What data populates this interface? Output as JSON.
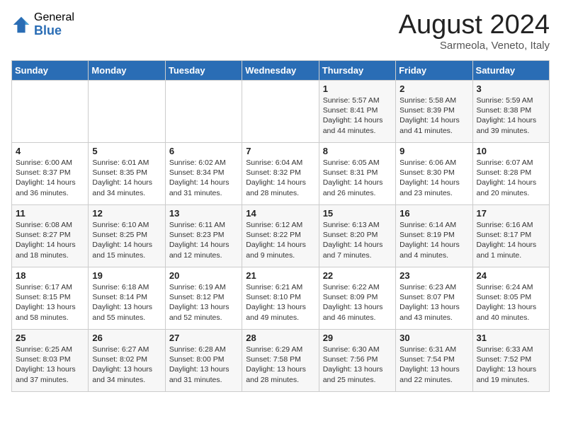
{
  "logo": {
    "general": "General",
    "blue": "Blue"
  },
  "title": "August 2024",
  "location": "Sarmeola, Veneto, Italy",
  "days_of_week": [
    "Sunday",
    "Monday",
    "Tuesday",
    "Wednesday",
    "Thursday",
    "Friday",
    "Saturday"
  ],
  "weeks": [
    [
      {
        "day": "",
        "info": ""
      },
      {
        "day": "",
        "info": ""
      },
      {
        "day": "",
        "info": ""
      },
      {
        "day": "",
        "info": ""
      },
      {
        "day": "1",
        "info": "Sunrise: 5:57 AM\nSunset: 8:41 PM\nDaylight: 14 hours and 44 minutes."
      },
      {
        "day": "2",
        "info": "Sunrise: 5:58 AM\nSunset: 8:39 PM\nDaylight: 14 hours and 41 minutes."
      },
      {
        "day": "3",
        "info": "Sunrise: 5:59 AM\nSunset: 8:38 PM\nDaylight: 14 hours and 39 minutes."
      }
    ],
    [
      {
        "day": "4",
        "info": "Sunrise: 6:00 AM\nSunset: 8:37 PM\nDaylight: 14 hours and 36 minutes."
      },
      {
        "day": "5",
        "info": "Sunrise: 6:01 AM\nSunset: 8:35 PM\nDaylight: 14 hours and 34 minutes."
      },
      {
        "day": "6",
        "info": "Sunrise: 6:02 AM\nSunset: 8:34 PM\nDaylight: 14 hours and 31 minutes."
      },
      {
        "day": "7",
        "info": "Sunrise: 6:04 AM\nSunset: 8:32 PM\nDaylight: 14 hours and 28 minutes."
      },
      {
        "day": "8",
        "info": "Sunrise: 6:05 AM\nSunset: 8:31 PM\nDaylight: 14 hours and 26 minutes."
      },
      {
        "day": "9",
        "info": "Sunrise: 6:06 AM\nSunset: 8:30 PM\nDaylight: 14 hours and 23 minutes."
      },
      {
        "day": "10",
        "info": "Sunrise: 6:07 AM\nSunset: 8:28 PM\nDaylight: 14 hours and 20 minutes."
      }
    ],
    [
      {
        "day": "11",
        "info": "Sunrise: 6:08 AM\nSunset: 8:27 PM\nDaylight: 14 hours and 18 minutes."
      },
      {
        "day": "12",
        "info": "Sunrise: 6:10 AM\nSunset: 8:25 PM\nDaylight: 14 hours and 15 minutes."
      },
      {
        "day": "13",
        "info": "Sunrise: 6:11 AM\nSunset: 8:23 PM\nDaylight: 14 hours and 12 minutes."
      },
      {
        "day": "14",
        "info": "Sunrise: 6:12 AM\nSunset: 8:22 PM\nDaylight: 14 hours and 9 minutes."
      },
      {
        "day": "15",
        "info": "Sunrise: 6:13 AM\nSunset: 8:20 PM\nDaylight: 14 hours and 7 minutes."
      },
      {
        "day": "16",
        "info": "Sunrise: 6:14 AM\nSunset: 8:19 PM\nDaylight: 14 hours and 4 minutes."
      },
      {
        "day": "17",
        "info": "Sunrise: 6:16 AM\nSunset: 8:17 PM\nDaylight: 14 hours and 1 minute."
      }
    ],
    [
      {
        "day": "18",
        "info": "Sunrise: 6:17 AM\nSunset: 8:15 PM\nDaylight: 13 hours and 58 minutes."
      },
      {
        "day": "19",
        "info": "Sunrise: 6:18 AM\nSunset: 8:14 PM\nDaylight: 13 hours and 55 minutes."
      },
      {
        "day": "20",
        "info": "Sunrise: 6:19 AM\nSunset: 8:12 PM\nDaylight: 13 hours and 52 minutes."
      },
      {
        "day": "21",
        "info": "Sunrise: 6:21 AM\nSunset: 8:10 PM\nDaylight: 13 hours and 49 minutes."
      },
      {
        "day": "22",
        "info": "Sunrise: 6:22 AM\nSunset: 8:09 PM\nDaylight: 13 hours and 46 minutes."
      },
      {
        "day": "23",
        "info": "Sunrise: 6:23 AM\nSunset: 8:07 PM\nDaylight: 13 hours and 43 minutes."
      },
      {
        "day": "24",
        "info": "Sunrise: 6:24 AM\nSunset: 8:05 PM\nDaylight: 13 hours and 40 minutes."
      }
    ],
    [
      {
        "day": "25",
        "info": "Sunrise: 6:25 AM\nSunset: 8:03 PM\nDaylight: 13 hours and 37 minutes."
      },
      {
        "day": "26",
        "info": "Sunrise: 6:27 AM\nSunset: 8:02 PM\nDaylight: 13 hours and 34 minutes."
      },
      {
        "day": "27",
        "info": "Sunrise: 6:28 AM\nSunset: 8:00 PM\nDaylight: 13 hours and 31 minutes."
      },
      {
        "day": "28",
        "info": "Sunrise: 6:29 AM\nSunset: 7:58 PM\nDaylight: 13 hours and 28 minutes."
      },
      {
        "day": "29",
        "info": "Sunrise: 6:30 AM\nSunset: 7:56 PM\nDaylight: 13 hours and 25 minutes."
      },
      {
        "day": "30",
        "info": "Sunrise: 6:31 AM\nSunset: 7:54 PM\nDaylight: 13 hours and 22 minutes."
      },
      {
        "day": "31",
        "info": "Sunrise: 6:33 AM\nSunset: 7:52 PM\nDaylight: 13 hours and 19 minutes."
      }
    ]
  ]
}
